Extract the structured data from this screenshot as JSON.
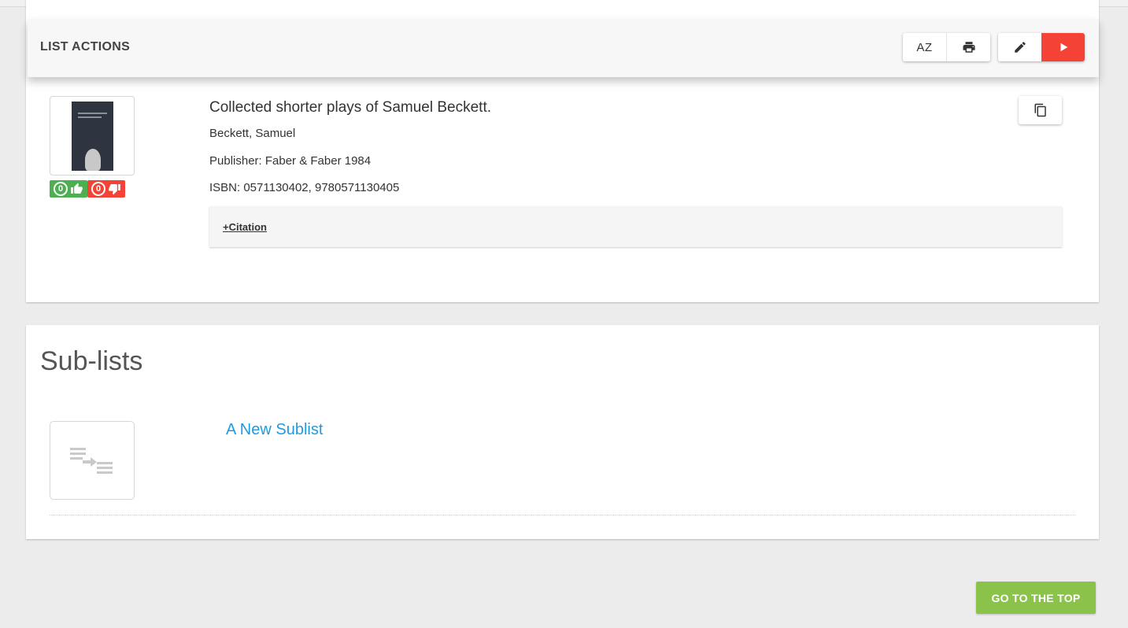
{
  "list_actions": {
    "label": "LIST ACTIONS",
    "sort_button": {
      "text": "AZ",
      "icon": "sort-az-icon"
    },
    "print_button": {
      "icon": "print-icon"
    },
    "edit_button": {
      "icon": "pencil-icon"
    },
    "play_button": {
      "icon": "play-icon"
    },
    "accent_color": "#f44336"
  },
  "record": {
    "title": "Collected shorter plays of Samuel Beckett.",
    "author": "Beckett, Samuel",
    "publisher": "Publisher: Faber & Faber 1984",
    "isbn": "ISBN: 0571130402, 9780571130405",
    "votes": {
      "up": "0",
      "down": "0"
    },
    "citation_link": "+Citation",
    "copy_icon": "copy-icon"
  },
  "sublists": {
    "heading": "Sub-lists",
    "items": [
      {
        "title": "A New Sublist",
        "icon": "sublist-icon"
      }
    ]
  },
  "go_top": {
    "label": "GO TO THE TOP",
    "color": "#8bc34a"
  }
}
